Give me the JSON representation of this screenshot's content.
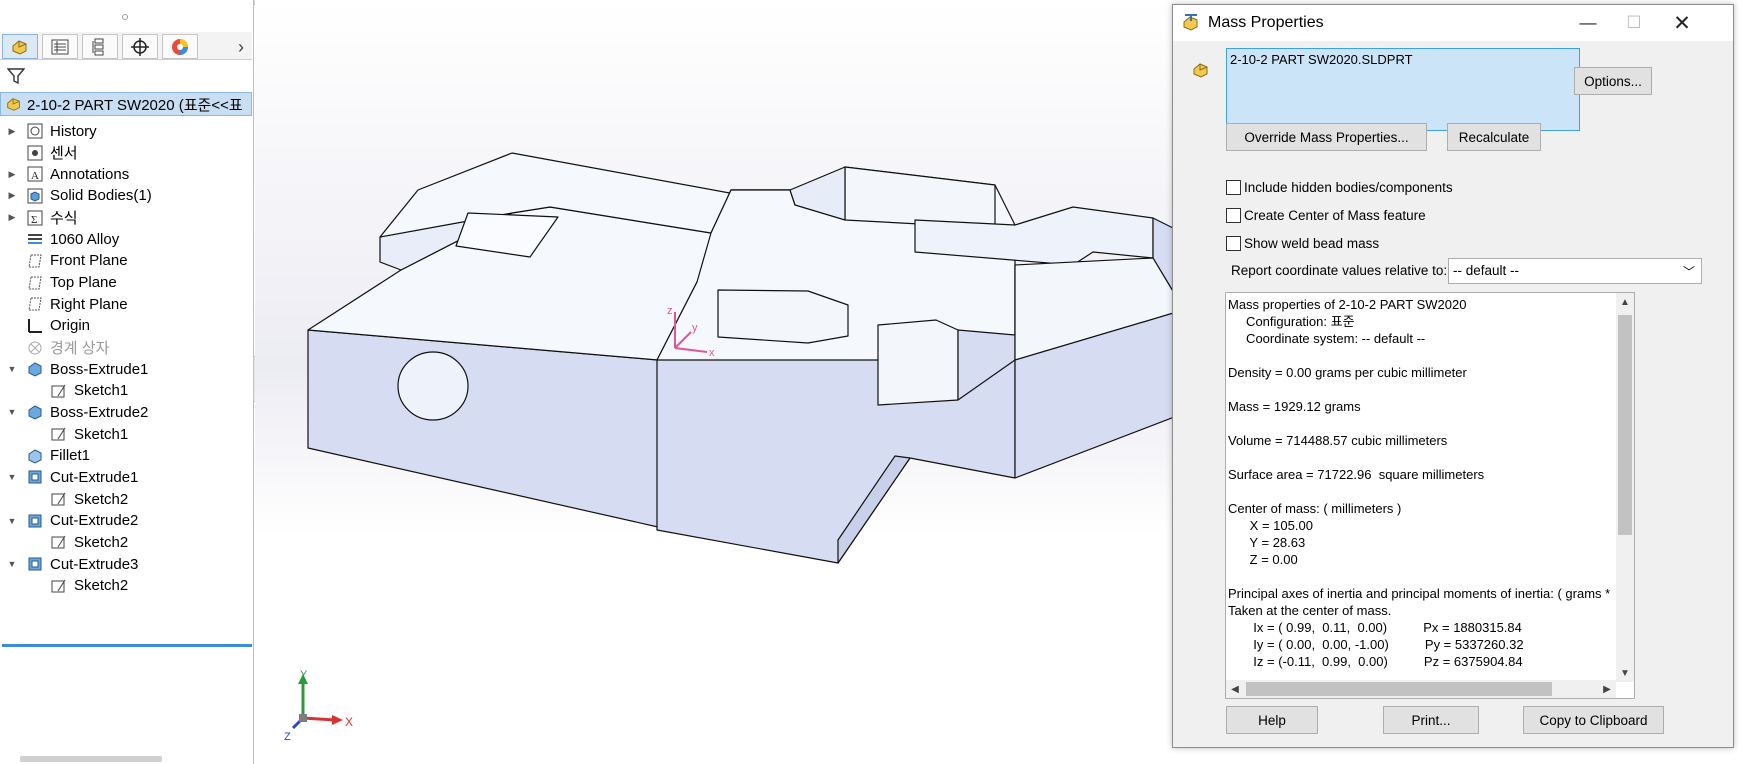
{
  "feature_manager": {
    "tabs": [
      "feature-manager-tab",
      "property-manager-tab",
      "configuration-manager-tab",
      "dimxpert-tab",
      "display-manager-tab"
    ],
    "root": "2-10-2 PART SW2020  (표준<<표",
    "tree": [
      {
        "label": "History",
        "icon": "history-icon",
        "expandable": true
      },
      {
        "label": "센서",
        "icon": "sensor-icon",
        "expandable": false
      },
      {
        "label": "Annotations",
        "icon": "annotations-icon",
        "expandable": true
      },
      {
        "label": "Solid Bodies(1)",
        "icon": "solid-bodies-icon",
        "expandable": true
      },
      {
        "label": "수식",
        "icon": "equations-icon",
        "expandable": true
      },
      {
        "label": "1060 Alloy",
        "icon": "material-icon",
        "expandable": false
      },
      {
        "label": "Front Plane",
        "icon": "plane-icon",
        "expandable": false
      },
      {
        "label": "Top Plane",
        "icon": "plane-icon",
        "expandable": false
      },
      {
        "label": "Right Plane",
        "icon": "plane-icon",
        "expandable": false
      },
      {
        "label": "Origin",
        "icon": "origin-icon",
        "expandable": false
      },
      {
        "label": "경계 상자",
        "icon": "bounding-box-icon",
        "expandable": false
      },
      {
        "label": "Boss-Extrude1",
        "icon": "boss-extrude-icon",
        "expandable": true
      },
      {
        "label": "Sketch1",
        "icon": "sketch-icon",
        "expandable": false
      },
      {
        "label": "Boss-Extrude2",
        "icon": "boss-extrude-icon",
        "expandable": true
      },
      {
        "label": "Sketch1",
        "icon": "sketch-icon",
        "expandable": false
      },
      {
        "label": "Fillet1",
        "icon": "fillet-icon",
        "expandable": false
      },
      {
        "label": "Cut-Extrude1",
        "icon": "cut-extrude-icon",
        "expandable": true
      },
      {
        "label": "Sketch2",
        "icon": "sketch-icon",
        "expandable": false
      },
      {
        "label": "Cut-Extrude2",
        "icon": "cut-extrude-icon",
        "expandable": true
      },
      {
        "label": "Sketch2",
        "icon": "sketch-icon",
        "expandable": false
      },
      {
        "label": "Cut-Extrude3",
        "icon": "cut-extrude-icon",
        "expandable": true
      },
      {
        "label": "Sketch2",
        "icon": "sketch-icon",
        "expandable": false
      }
    ]
  },
  "viewport": {
    "origin_axes": {
      "x": "x",
      "y": "y",
      "z": "z"
    },
    "triad": {
      "x": "X",
      "y": "Y",
      "z": "Z"
    }
  },
  "dialog": {
    "title": "Mass Properties",
    "selected_file": "2-10-2 PART SW2020.SLDPRT",
    "options_button": "Options...",
    "override_button": "Override Mass Properties...",
    "recalculate_button": "Recalculate",
    "checkboxes": [
      {
        "label": "Include hidden bodies/components",
        "checked": false
      },
      {
        "label": "Create Center of Mass feature",
        "checked": false
      },
      {
        "label": "Show weld bead mass",
        "checked": false
      }
    ],
    "report_label": "Report coordinate values relative to:",
    "report_value": "-- default --",
    "results": [
      "Mass properties of 2-10-2 PART SW2020",
      "     Configuration: 표준",
      "     Coordinate system: -- default --",
      "",
      "Density = 0.00 grams per cubic millimeter",
      "",
      "Mass = 1929.12 grams",
      "",
      "Volume = 714488.57 cubic millimeters",
      "",
      "Surface area = 71722.96  square millimeters",
      "",
      "Center of mass: ( millimeters )",
      "      X = 105.00",
      "      Y = 28.63",
      "      Z = 0.00",
      "",
      "Principal axes of inertia and principal moments of inertia: ( grams *  square",
      "Taken at the center of mass.",
      "       Ix = ( 0.99,  0.11,  0.00)          Px = 1880315.84",
      "       Iy = ( 0.00,  0.00, -1.00)          Py = 5337260.32",
      "       Iz = (-0.11,  0.99,  0.00)          Pz = 6375904.84"
    ],
    "help_button": "Help",
    "print_button": "Print...",
    "copy_button": "Copy to Clipboard"
  },
  "colors": {
    "selection_blue": "#c7def3",
    "model_face": "#dde4f7",
    "accent": "#3a8dd6"
  }
}
